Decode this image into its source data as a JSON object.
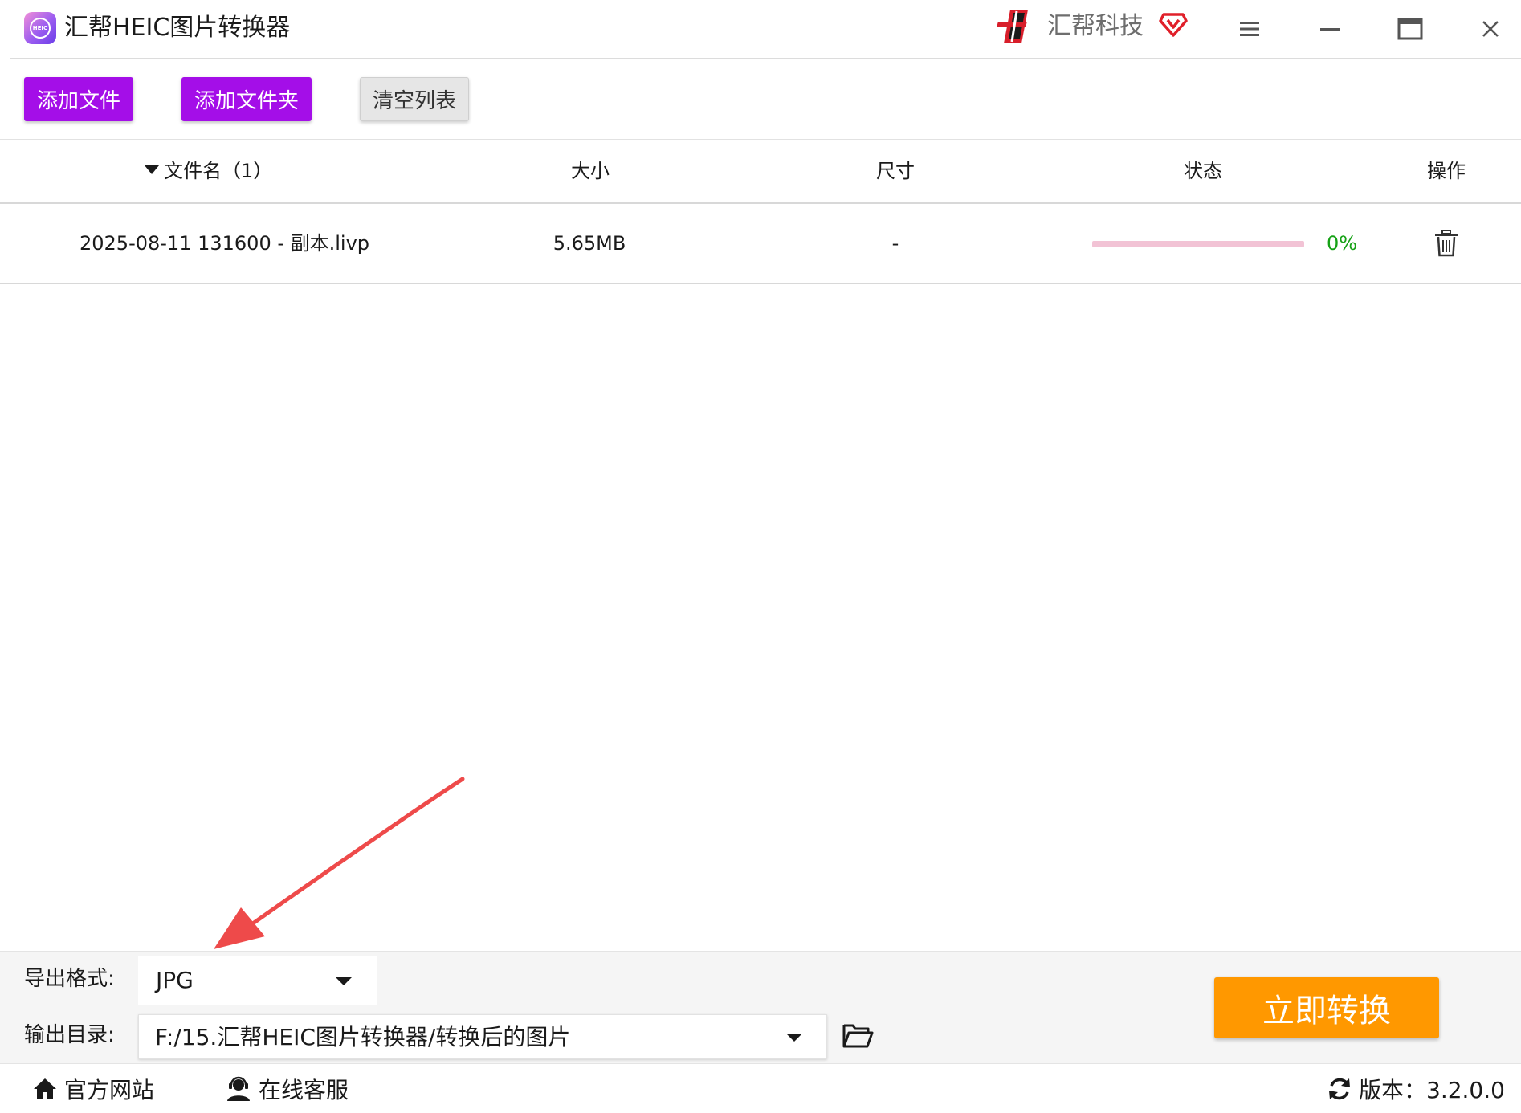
{
  "window": {
    "title": "汇帮HEIC图片转换器",
    "logo_icon": "heic-app-icon",
    "logo_text": "HEIC",
    "brand": "汇帮科技",
    "brand_icon": "huibang-logo-icon",
    "vip_icon": "vip-diamond-icon",
    "controls": [
      "menu-icon",
      "minimize-icon",
      "maximize-icon",
      "close-icon"
    ]
  },
  "toolbar": {
    "add_file": "添加文件",
    "add_folder": "添加文件夹",
    "clear_list": "清空列表"
  },
  "table": {
    "columns": {
      "name": "文件名（1）",
      "size": "大小",
      "dimensions": "尺寸",
      "status": "状态",
      "action": "操作"
    },
    "rows": [
      {
        "name": "2025-08-11 131600 - 副本.livp",
        "size": "5.65MB",
        "dimensions": "-",
        "progress": 0,
        "progress_text": "0%",
        "action_icon": "trash-icon"
      }
    ]
  },
  "settings": {
    "format_label": "导出格式:",
    "format_value": "JPG",
    "output_label": "输出目录:",
    "output_value": "F:/15.汇帮HEIC图片转换器/转换后的图片",
    "convert_button": "立即转换"
  },
  "footer": {
    "site": "官方网站",
    "service": "在线客服",
    "version": "版本：3.2.0.0"
  },
  "colors": {
    "primary_purple": "#a40ee8",
    "convert_orange": "#ff9800",
    "progress_pink": "#f2c3d5",
    "percent_green": "#16a116",
    "annotation_red": "#ee4a4a"
  }
}
